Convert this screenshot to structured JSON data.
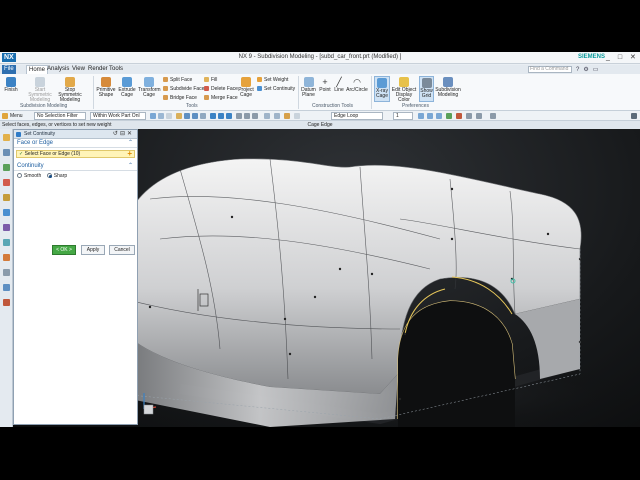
{
  "window": {
    "app_logo": "NX",
    "title": "NX 9 - Subdivision Modeling - [subd_car_front.prt (Modified) ]",
    "brand": "SIEMENS",
    "controls": [
      "_",
      "□",
      "✕"
    ]
  },
  "menu": {
    "tabs": [
      "File",
      "Home",
      "Analysis",
      "View",
      "Render",
      "Tools"
    ],
    "active_tab": "Home",
    "command_finder_placeholder": "Find a Command"
  },
  "ribbon": {
    "subdivision_modeling": {
      "label": "Subdivision Modeling",
      "buttons": [
        "Finish",
        "Start Symmetric Modeling",
        "Stop Symmetric Modeling"
      ]
    },
    "tools": {
      "label": "Tools",
      "buttons": [
        "Primitive Shape",
        "Extrude Cage",
        "Transform Cage"
      ],
      "small_commands": [
        "Split Face",
        "Subdivide Face",
        "Bridge Face",
        "Fill",
        "Delete Face",
        "Merge Face",
        "Project Cage",
        "Set Weight",
        "Set Continuity"
      ]
    },
    "construction_tools": {
      "label": "Construction Tools",
      "buttons": [
        "Datum Plane",
        "Point",
        "Line",
        "Arc/Circle"
      ]
    },
    "preferences": {
      "label": "Preferences",
      "buttons": [
        "X-ray Cage",
        "Edit Object Display Color",
        "Show Grid",
        "Subdivision Modeling"
      ]
    }
  },
  "toolbar": {
    "menu_label": "Menu",
    "selection_filter": "No Selection Filter",
    "scope": "Within Work Part Onl",
    "cage_filter": "Edge Loop",
    "count": "1"
  },
  "status": {
    "prompt": "Select faces, edges, or vertices to set new weight",
    "center": "Cage Edge"
  },
  "dialog": {
    "title": "Set Continuity",
    "section_face_or_edge": "Face or Edge",
    "selection": "Select Face or Edge (10)",
    "section_continuity": "Continuity",
    "options": [
      "Smooth",
      "Sharp"
    ],
    "selected_option": "Sharp",
    "buttons": {
      "ok": "< OK >",
      "apply": "Apply",
      "cancel": "Cancel"
    }
  },
  "colors": {
    "accent": "#2e6fb0",
    "selection_highlight": "#fff4b8",
    "ok_green": "#45a845",
    "siemens_teal": "#0a9b9b"
  }
}
